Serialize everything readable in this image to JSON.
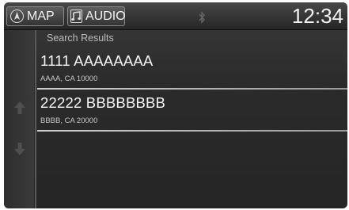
{
  "topbar": {
    "map_label": "MAP",
    "audio_label": "AUDIO",
    "clock": "12:34"
  },
  "header": {
    "label": "Search Results"
  },
  "results": [
    {
      "title": "1111 AAAAAAAA",
      "address": "AAAA, CA 10000"
    },
    {
      "title": "22222 BBBBBBBB",
      "address": "BBBB, CA 20000"
    }
  ],
  "colors": {
    "text": "#f5f5f5",
    "background": "#2b2b2b",
    "divider": "#cfcfcf"
  }
}
